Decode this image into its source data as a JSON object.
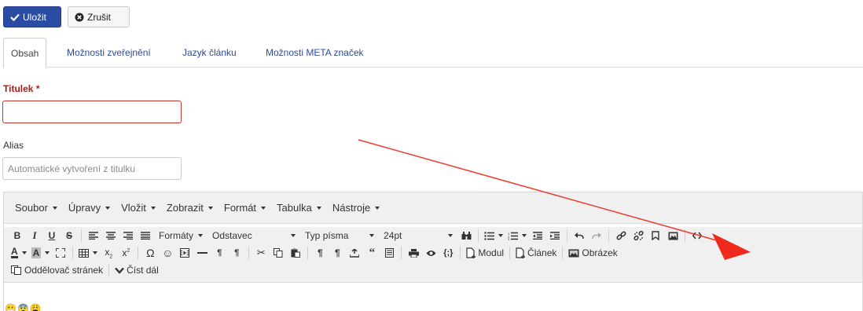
{
  "actions": {
    "save_label": "Uložit",
    "cancel_label": "Zrušit"
  },
  "tabs": [
    {
      "label": "Obsah",
      "active": true
    },
    {
      "label": "Možnosti zveřejnění",
      "active": false
    },
    {
      "label": "Jazyk článku",
      "active": false
    },
    {
      "label": "Možnosti META značek",
      "active": false
    }
  ],
  "form": {
    "title_label": "Titulek",
    "title_required_mark": "*",
    "title_value": "",
    "alias_label": "Alias",
    "alias_placeholder": "Automatické vytvoření z titulku"
  },
  "editor": {
    "menu": [
      "Soubor",
      "Úpravy",
      "Vložit",
      "Zobrazit",
      "Formát",
      "Tabulka",
      "Nástroje"
    ],
    "formats_label": "Formáty",
    "paragraph_label": "Odstavec",
    "font_family_label": "Typ písma",
    "font_size_label": "24pt",
    "module_button": "Modul",
    "article_button": "Článek",
    "image_button": "Obrázek",
    "pagebreak_button": "Oddělovač stránek",
    "readmore_button": "Číst dál",
    "content_emoji": "😬😨😩"
  },
  "colors": {
    "primary": "#2a4ca3",
    "required_label": "#a51f18",
    "link": "#2a4aa0",
    "annotation_arrow": "#ee3b2e"
  }
}
